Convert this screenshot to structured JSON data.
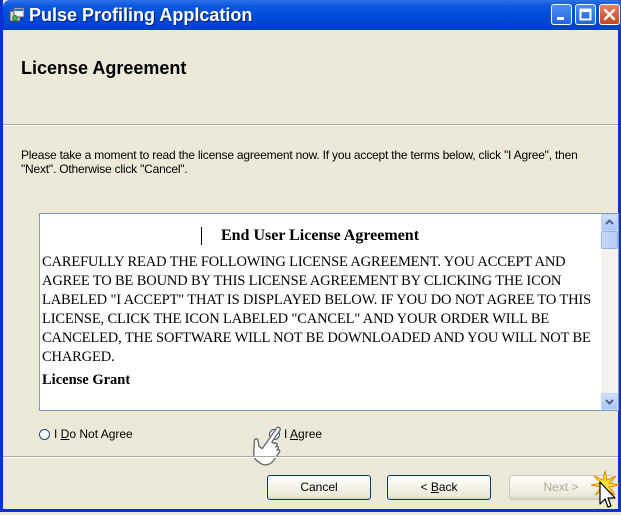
{
  "window": {
    "title": "Pulse Profiling Applcation",
    "icons": {
      "app": "installer-icon",
      "minimize": "minimize-icon",
      "maximize": "maximize-icon",
      "close": "close-icon"
    }
  },
  "header": {
    "title": "License Agreement"
  },
  "instructions": "Please take a moment to read the license agreement now. If you accept the terms below, click \"I Agree\", then \"Next\". Otherwise click \"Cancel\".",
  "license": {
    "title": "End User License Agreement",
    "body": "CAREFULLY READ THE FOLLOWING LICENSE AGREEMENT. YOU ACCEPT AND AGREE TO BE BOUND BY THIS LICENSE AGREEMENT BY CLICKING THE ICON LABELED \"I ACCEPT\" THAT IS DISPLAYED BELOW. IF YOU DO NOT AGREE TO THIS LICENSE, CLICK THE ICON LABELED \"CANCEL\" AND YOUR ORDER WILL BE CANCELED, THE SOFTWARE WILL NOT BE DOWNLOADED AND YOU WILL NOT BE CHARGED.",
    "subheading": "License Grant"
  },
  "options": {
    "do_not_agree": {
      "prefix": "I ",
      "mnemonic": "D",
      "rest": "o Not Agree",
      "selected": false
    },
    "agree": {
      "prefix": "I ",
      "mnemonic": "A",
      "rest": "gree",
      "selected": false
    }
  },
  "buttons": {
    "cancel": "Cancel",
    "back_mnemonic": "B",
    "back_rest": "ack",
    "back_prefix": "< ",
    "next": "Next >",
    "next_enabled": false
  },
  "colors": {
    "titlebar": "#0049d9",
    "dialog_bg": "#ece9d8",
    "border": "#0831d9",
    "disabled_text": "#aca899"
  }
}
